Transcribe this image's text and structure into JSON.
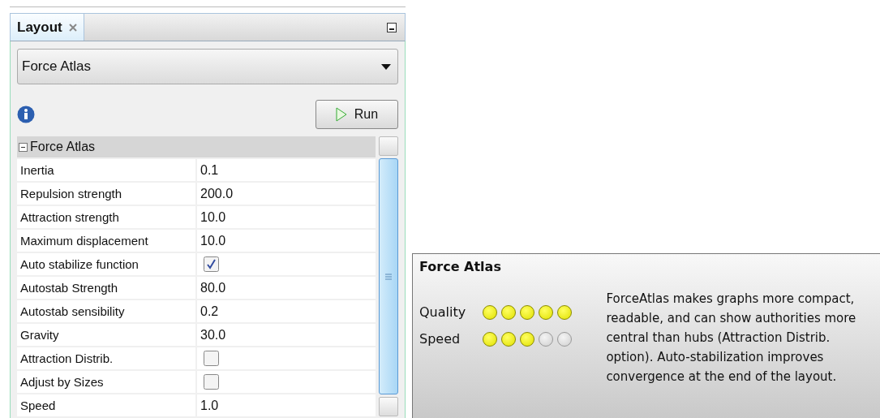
{
  "panel": {
    "tab": {
      "label": "Layout",
      "selected": true
    },
    "dropdown": {
      "value": "Force Atlas"
    },
    "run_button": {
      "label": "Run"
    },
    "properties": {
      "group": "Force Atlas",
      "expanded": true,
      "rows": [
        {
          "kind": "value",
          "name": "Inertia",
          "value": "0.1"
        },
        {
          "kind": "value",
          "name": "Repulsion strength",
          "value": "200.0"
        },
        {
          "kind": "value",
          "name": "Attraction strength",
          "value": "10.0"
        },
        {
          "kind": "value",
          "name": "Maximum displacement",
          "value": "10.0"
        },
        {
          "kind": "checkbox",
          "name": "Auto stabilize function",
          "checked": true
        },
        {
          "kind": "value",
          "name": "Autostab Strength",
          "value": "80.0"
        },
        {
          "kind": "value",
          "name": "Autostab sensibility",
          "value": "0.2"
        },
        {
          "kind": "value",
          "name": "Gravity",
          "value": "30.0"
        },
        {
          "kind": "checkbox",
          "name": "Attraction Distrib.",
          "checked": false
        },
        {
          "kind": "checkbox",
          "name": "Adjust by Sizes",
          "checked": false
        },
        {
          "kind": "value",
          "name": "Speed",
          "value": "1.0"
        }
      ]
    }
  },
  "info_card": {
    "title": "Force Atlas",
    "ratings": [
      {
        "label": "Quality",
        "stars": 5
      },
      {
        "label": "Speed",
        "stars": 3
      }
    ],
    "description": "ForceAtlas makes graphs more compact, readable, and can show authorities more central than hubs (Attraction Distrib. option). Auto-stabilization improves convergence at the end of the layout."
  }
}
